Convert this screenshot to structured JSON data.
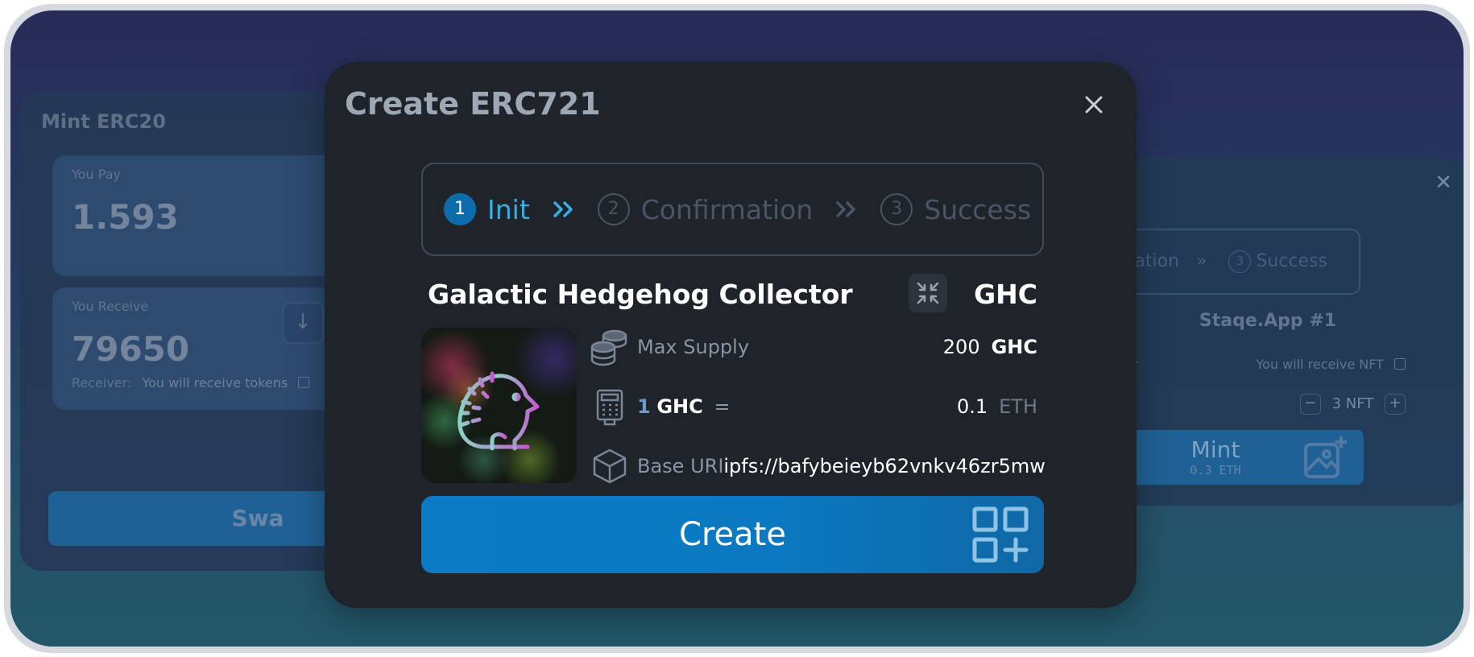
{
  "background": {
    "left_card": {
      "title": "Mint ERC20",
      "pay_label": "You Pay",
      "pay_value": "1.593",
      "receive_label": "You Receive",
      "receive_value": "79650",
      "receiver_label": "Receiver:",
      "receiver_value": "You will receive tokens",
      "swap_label": "Swa"
    },
    "right_card": {
      "steps_text": "onfirmation",
      "step3_num": "3",
      "step3_label": "Success",
      "title": "Staqe.App #1",
      "receiver_label": "eiver",
      "receive_note": "You will receive NFT",
      "qty_text": "3 NFT",
      "mint_label": "Mint",
      "mint_price": "0.3 ETH"
    }
  },
  "modal": {
    "title": "Create ERC721",
    "steps": [
      {
        "num": "1",
        "label": "Init"
      },
      {
        "num": "2",
        "label": "Confirmation"
      },
      {
        "num": "3",
        "label": "Success"
      }
    ],
    "nft_name": "Galactic Hedgehog Collector",
    "nft_symbol": "GHC",
    "max_supply": {
      "label": "Max Supply",
      "value": "200",
      "unit": "GHC"
    },
    "price": {
      "qty": "1",
      "unit": "GHC",
      "eq": "=",
      "value": "0.1",
      "currency": "ETH"
    },
    "base_uri": {
      "label": "Base URI",
      "value": "ipfs://bafybeieyb62vnkv46zr5mw"
    },
    "create_label": "Create"
  },
  "colors": {
    "accent": "#0a7bc4",
    "modal_bg": "#1f232a",
    "active_step": "#38aee6"
  },
  "icons": [
    "close-icon",
    "double-chevron-right-icon",
    "shrink-arrows-icon",
    "coins-stack-icon",
    "calculator-icon",
    "cube-icon",
    "grid-plus-icon",
    "hedgehog-image",
    "image-plus-icon",
    "arrow-down-icon",
    "edit-icon"
  ]
}
